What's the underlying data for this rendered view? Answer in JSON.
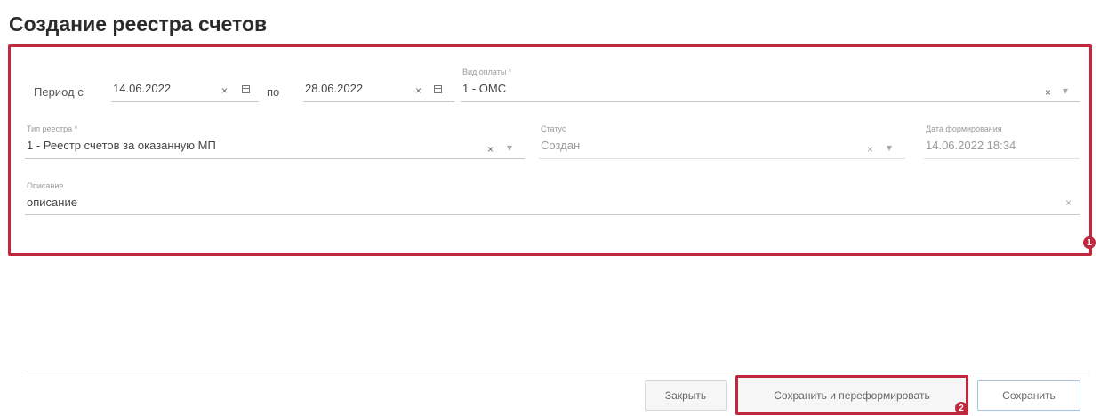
{
  "page_title": "Создание реестра счетов",
  "markers": [
    "1",
    "2"
  ],
  "form": {
    "period": {
      "label_from": "Период с",
      "from_value": "14.06.2022",
      "label_to": "по",
      "to_value": "28.06.2022"
    },
    "payment_type": {
      "label": "Вид оплаты *",
      "value": "1 - ОМС"
    },
    "registry_type": {
      "label": "Тип реестра *",
      "value": "1 - Реестр счетов за оказанную МП"
    },
    "status": {
      "label": "Статус",
      "value": "Создан"
    },
    "formation_date": {
      "label": "Дата формирования",
      "value": "14.06.2022 18:34"
    },
    "description": {
      "label": "Описание",
      "value": "описание"
    }
  },
  "icons": {
    "clear": "×",
    "dropdown": "▾"
  },
  "footer": {
    "close_label": "Закрыть",
    "save_reform_label": "Сохранить и переформировать",
    "save_label": "Сохранить"
  },
  "colors": {
    "highlight": "#c0283e",
    "save_border": "#a9c4de"
  }
}
